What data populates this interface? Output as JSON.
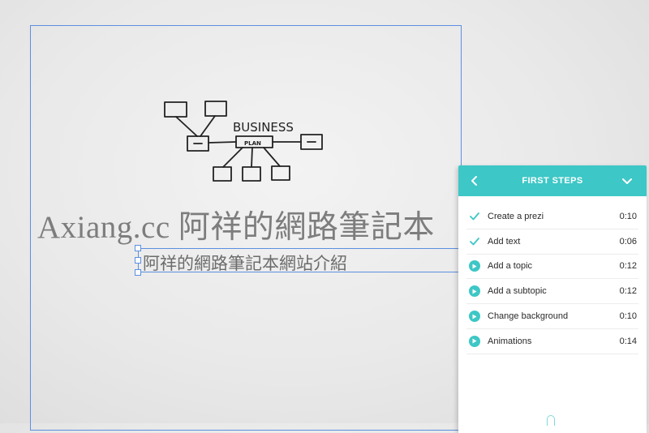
{
  "canvas": {
    "sketch": {
      "word_business": "BUSINESS",
      "word_plan": "PLAN"
    },
    "title": "Axiang.cc  阿祥的網路筆記本",
    "subtitle": "阿祥的網路筆記本網站介紹"
  },
  "panel": {
    "title": "FIRST STEPS",
    "accent_color": "#3dc7c6",
    "back_icon": "chevron-left-icon",
    "collapse_icon": "chevron-down-icon",
    "steps": [
      {
        "label": "Create a prezi",
        "time": "0:10",
        "status": "done"
      },
      {
        "label": "Add text",
        "time": "0:06",
        "status": "done"
      },
      {
        "label": "Add a topic",
        "time": "0:12",
        "status": "todo"
      },
      {
        "label": "Add a subtopic",
        "time": "0:12",
        "status": "todo"
      },
      {
        "label": "Change background",
        "time": "0:10",
        "status": "todo"
      },
      {
        "label": "Animations",
        "time": "0:14",
        "status": "todo"
      }
    ]
  }
}
